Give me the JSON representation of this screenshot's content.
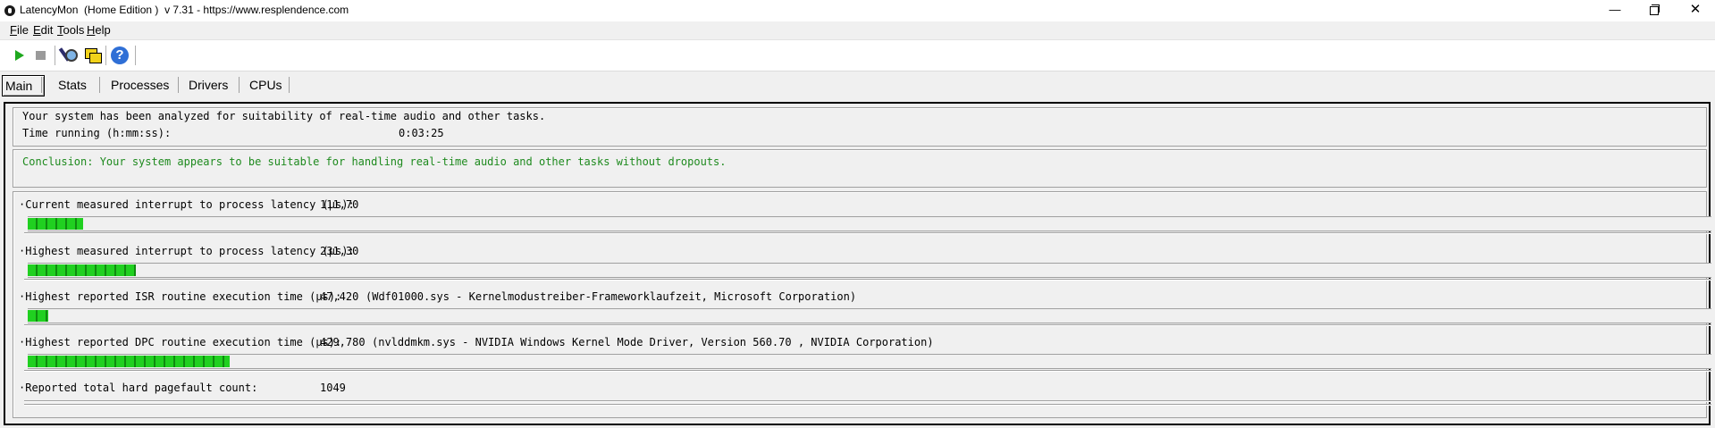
{
  "window": {
    "title": "LatencyMon  (Home Edition )  v 7.31 - https://www.resplendence.com",
    "minimize_glyph": "—",
    "close_glyph": "✕"
  },
  "menu": {
    "items": [
      "File",
      "Edit",
      "Tools",
      "Help"
    ]
  },
  "toolbar": {
    "buttons": [
      "play-icon",
      "stop-icon",
      "spy-icon",
      "windows-icon",
      "help-icon"
    ],
    "help_glyph": "?"
  },
  "tabs": {
    "items": [
      "Main",
      "Stats",
      "Processes",
      "Drivers",
      "CPUs"
    ],
    "active": "Main"
  },
  "summary": {
    "line1": "Your system has been analyzed for suitability of real-time audio and other tasks.",
    "time_label": "Time running (h:mm:ss):",
    "time_value": "0:03:25"
  },
  "conclusion": {
    "text": "Conclusion: Your system appears to be suitable for handling real-time audio and other tasks without dropouts.",
    "color": "#1e8a1e"
  },
  "metrics": [
    {
      "label": "·Current measured interrupt to process latency (µs):",
      "value": "111,70",
      "detail": "",
      "bar_fraction": 0.033
    },
    {
      "label": "·Highest measured interrupt to process latency (µs):",
      "value": "231,30",
      "detail": "",
      "bar_fraction": 0.064
    },
    {
      "label": "·Highest reported ISR routine execution time (µs):",
      "value": "47,420",
      "detail": "(Wdf01000.sys - Kernelmodustreiber-Frameworklaufzeit, Microsoft Corporation)",
      "bar_fraction": 0.012
    },
    {
      "label": "·Highest reported DPC routine execution time (µs):",
      "value": "429,780",
      "detail": "(nvlddmkm.sys - NVIDIA Windows Kernel Mode Driver, Version 560.70 , NVIDIA Corporation)",
      "bar_fraction": 0.12
    },
    {
      "label": "·Reported total hard pagefault count:",
      "value": "1049",
      "detail": ""
    }
  ],
  "colors": {
    "bar_green": "#20d020",
    "bar_dark_green": "#108a10"
  }
}
